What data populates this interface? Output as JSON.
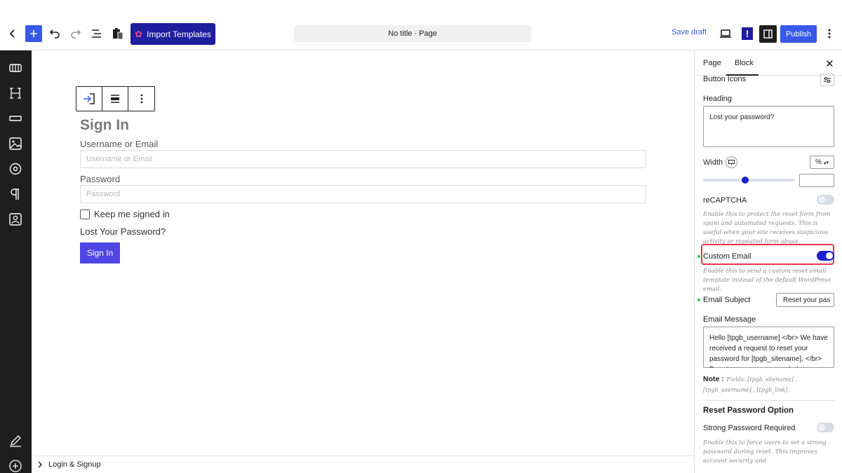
{
  "toolbar": {
    "back_icon": "chevron-left-icon",
    "add_icon": "plus-icon",
    "undo_icon": "undo-icon",
    "redo_icon": "redo-icon",
    "list_view_icon": "list-view-icon",
    "clipboard_icon": "clipboard-icon",
    "import_label": "Import Templates",
    "doc_title": "No title · Page",
    "save_draft_label": "Save draft",
    "preview_icon": "laptop-icon",
    "plugin_badge": "!",
    "settings_icon": "sidebar-icon",
    "publish_label": "Publish",
    "options_icon": "vertical-dots-icon"
  },
  "left_sidebar": {
    "items": [
      "table-icon",
      "heading-icon",
      "divider-icon",
      "image-icon",
      "circle-icon",
      "paragraph-icon",
      "contact-icon"
    ],
    "bottom_items": [
      "pencil-icon",
      "plus-circle-icon"
    ]
  },
  "block_toolbar": {
    "items": [
      "login-icon",
      "align-icon",
      "more-icon"
    ]
  },
  "form": {
    "title": "Sign In",
    "username_label": "Username or Email",
    "username_placeholder": "Username or Email",
    "password_label": "Password",
    "password_placeholder": "Password",
    "remember_label": "Keep me signed in",
    "lost_password": "Lost Your Password?",
    "submit_label": "Sign In"
  },
  "breadcrumb": {
    "label": "Login & Signup"
  },
  "panel": {
    "tabs": [
      "Page",
      "Block"
    ],
    "button_icons_label": "Button Icons",
    "heading_label": "Heading",
    "heading_value": "Lost your password?",
    "width_label": "Width",
    "width_unit": "%",
    "width_slider_value": 0.46,
    "recaptcha_label": "reCAPTCHA",
    "recaptcha_on": false,
    "recaptcha_help": "Enable this to protect the reset form from spam and automated requests. This is useful when your site receives suspicious activity or repeated form abuse.",
    "custom_email_label": "Custom Email",
    "custom_email_on": true,
    "custom_email_help": "Enable this to send a custom reset email template instead of the default WordPress email.",
    "email_subject_label": "Email Subject",
    "email_subject_value": "Reset your pas",
    "email_message_label": "Email Message",
    "email_message_value": "Hello [tpgb_username] </br> We have received a request to reset your password for [tpgb_sitename]. </br> To set your new password please, c",
    "note_label": "Note :",
    "note_text": "Fields: [tpgb_sitename] , [tpgb_username] , [tpgb_link]",
    "reset_option_heading": "Reset Password Option",
    "strong_password_label": "Strong Password Required",
    "strong_password_on": false,
    "strong_password_help": "Enable this to force users to set a strong password during reset. This improves account security and",
    "highlight_color": "#e8344e",
    "accent_color": "#1e1ecc"
  }
}
